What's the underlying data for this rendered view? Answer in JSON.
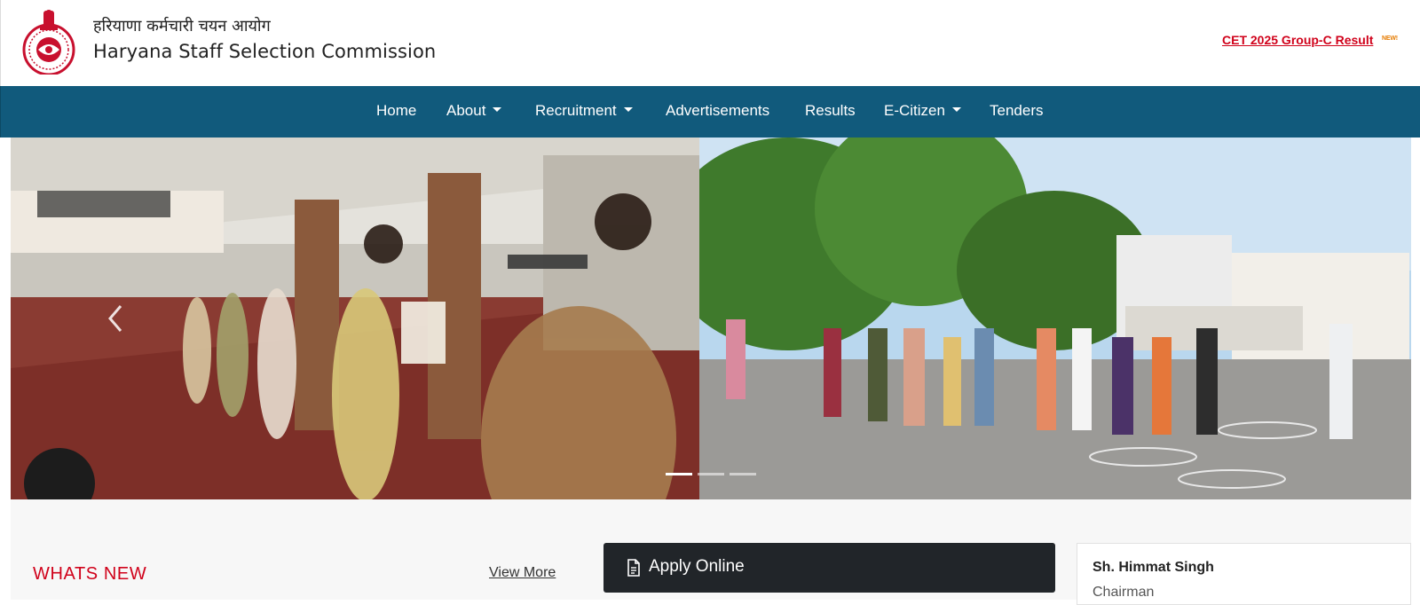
{
  "header": {
    "title_hindi": "हरियाणा कर्मचारी चयन आयोग",
    "title_english": "Haryana Staff Selection Commission",
    "emblem_icon": "haryana-emblem-logo",
    "announcement_link": "CET 2025 Group-C Result",
    "announcement_badge": "NEW!"
  },
  "nav": {
    "items": [
      {
        "label": "Home",
        "dropdown": false
      },
      {
        "label": "About",
        "dropdown": true
      },
      {
        "label": "Recruitment",
        "dropdown": true
      },
      {
        "label": "Advertisements",
        "dropdown": false
      },
      {
        "label": "Results",
        "dropdown": false
      },
      {
        "label": "E-Citizen",
        "dropdown": true
      },
      {
        "label": "Tenders",
        "dropdown": false
      }
    ]
  },
  "carousel": {
    "slides": 3,
    "active_slide": 1,
    "prev_icon": "chevron-left-icon"
  },
  "whats_new": {
    "title": "WHATS NEW",
    "view_more": "View More"
  },
  "apply": {
    "label": "Apply Online",
    "icon": "document-icon"
  },
  "chairman": {
    "name": "Sh. Himmat Singh",
    "role": "Chairman"
  },
  "colors": {
    "navbar": "#115a7c",
    "accent_red": "#d0021b",
    "apply_button": "#212529"
  }
}
